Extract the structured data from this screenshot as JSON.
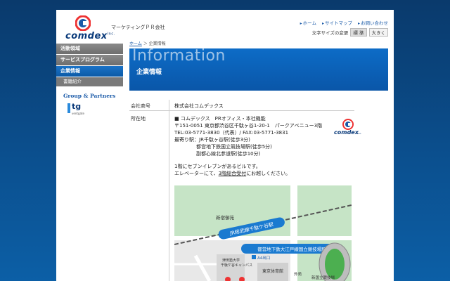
{
  "header": {
    "logo_text": "comdex",
    "logo_suffix": "Inc.",
    "company_tag": "マーケティングＰＲ会社",
    "links": [
      "ホーム",
      "サイトマップ",
      "お問い合わせ"
    ],
    "fontsize_label": "文字サイズの変更",
    "fontsize_options": [
      "標 準",
      "大きく"
    ]
  },
  "sidebar": {
    "items": [
      "活動領域",
      "サービスプログラム",
      "企業情報"
    ],
    "sub_item": "書籍紹介",
    "group_title": "Group & Partners",
    "partner_logo": "tg",
    "partner_sub": "ventgate"
  },
  "breadcrumb": {
    "home": "ホーム",
    "current": "企業情報"
  },
  "hero": {
    "title": "Information",
    "subtitle": "企業情報"
  },
  "info": {
    "company_label": "会社商号",
    "company_value": "株式会社コムデックス",
    "address_label": "所在地",
    "office": "■ コムデックス　PRオフィス・本社機能",
    "postal": "〒151-0051 東京都渋谷区千駄ヶ谷1-20-1　パークアベニュー3階",
    "tel": "TEL:03-5771-3830（代表）/ FAX:03-5771-3831",
    "station1": "最寄り駅：JR千駄ヶ谷駅(徒歩3分)",
    "station2": "都営地下鉄国立競技場駅(徒歩5分)",
    "station3": "副都心線北参道駅(徒歩10分)",
    "note1": "1階にセブンイレブンがあるビルです。",
    "note2_a": "エレベーターにて、",
    "note2_link": "3階総合受付",
    "note2_b": "にお越しください。"
  },
  "map": {
    "park": "新宿御苑",
    "jr_line": "JR総武線千駄ケ谷駅",
    "metro": "都営地下鉄大江戸線国立競技場駅",
    "exit": "A4出口",
    "univ1": "津田塾大学",
    "univ2": "千駄ケ谷キャンパス",
    "gym": "東京体育館",
    "outer": "外苑",
    "stadium": "新国立競技場"
  }
}
